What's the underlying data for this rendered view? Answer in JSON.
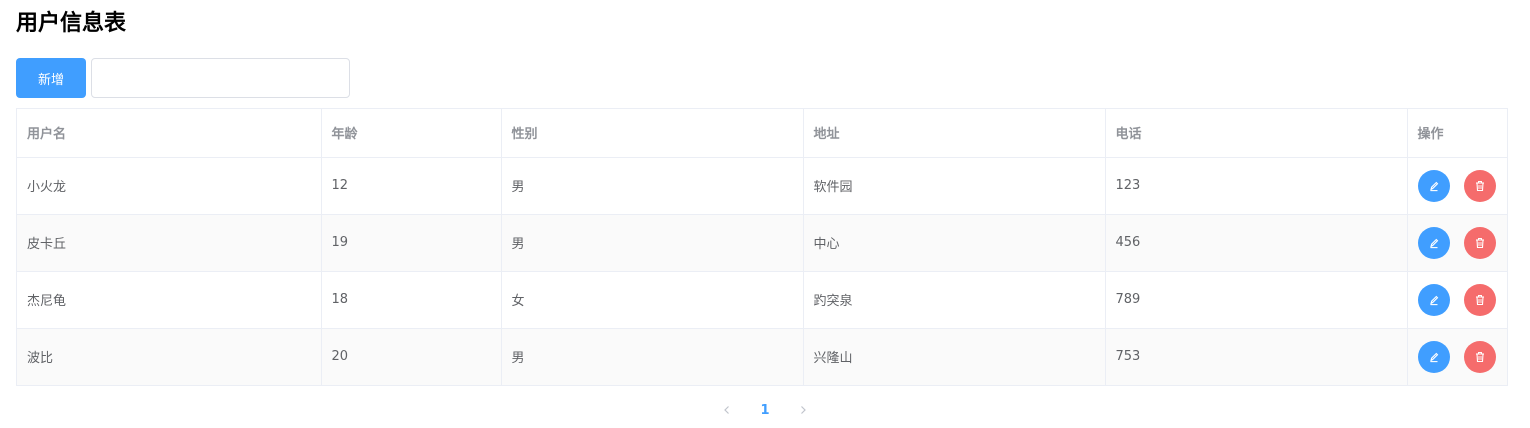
{
  "page": {
    "title": "用户信息表"
  },
  "toolbar": {
    "add_label": "新增",
    "search_value": "",
    "search_placeholder": ""
  },
  "table": {
    "headers": [
      "用户名",
      "年龄",
      "性别",
      "地址",
      "电话",
      "操作"
    ],
    "rows": [
      {
        "username": "小火龙",
        "age": "12",
        "gender": "男",
        "address": "软件园",
        "phone": "123"
      },
      {
        "username": "皮卡丘",
        "age": "19",
        "gender": "男",
        "address": "中心",
        "phone": "456"
      },
      {
        "username": "杰尼龟",
        "age": "18",
        "gender": "女",
        "address": "趵突泉",
        "phone": "789"
      },
      {
        "username": "波比",
        "age": "20",
        "gender": "男",
        "address": "兴隆山",
        "phone": "753"
      }
    ],
    "row_actions": {
      "edit_icon": "edit-icon",
      "delete_icon": "delete-icon"
    }
  },
  "pagination": {
    "current_page": "1",
    "prev_icon": "chevron-left-icon",
    "next_icon": "chevron-right-icon"
  },
  "colors": {
    "primary": "#409eff",
    "danger": "#f56c6c",
    "header_text": "#909399",
    "body_text": "#606266",
    "stripe": "#fafafa",
    "border": "#ebeef5"
  }
}
